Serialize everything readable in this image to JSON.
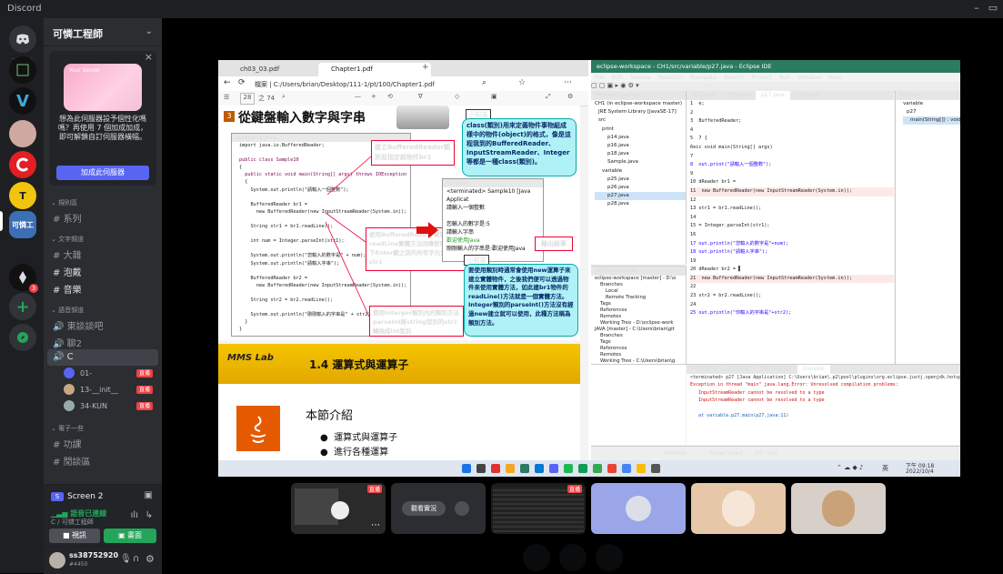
{
  "app": {
    "title": "Discord"
  },
  "server": {
    "name": "可憐工程師"
  },
  "promo": {
    "tag": "Your Server",
    "text": "想為此伺服器設予個性化嗎嗎？再使用 7 個加成加成，即可解鎖自訂伺服器橫幅。",
    "button": "加成此伺服器"
  },
  "categories": {
    "text": "文字頻道",
    "voice": "語音頻道",
    "forum": "電子一些"
  },
  "top_channel": "系列",
  "text_channels": [
    "大雜",
    "泡戴",
    "音樂"
  ],
  "voice_channels": [
    "東談談吧",
    "聊2",
    "C"
  ],
  "voice_users": [
    {
      "name": "01-",
      "status": "直播"
    },
    {
      "name": "13-__init__",
      "status": "直播"
    },
    {
      "name": "34-KUN",
      "status": "直播"
    }
  ],
  "more_channels": [
    "功課",
    "閒談區"
  ],
  "screen_share": {
    "label": "Screen 2"
  },
  "voice_status": {
    "title": "語音已連線",
    "subtitle": "C / 可憐工程師"
  },
  "voice_buttons": {
    "camera": "視訊",
    "screen": "畫面"
  },
  "user": {
    "name": "ss38752920",
    "tag": "#4450"
  },
  "pdf": {
    "tabs": [
      "ch03_03.pdf",
      "Chapter1.pdf"
    ],
    "address": "檔案 | C:/Users/brian/Desktop/111-1/pt/100/Chapter1.pdf",
    "page_num": "28",
    "page_total": "之 74",
    "slide_title": "從鍵盤輸入數字與字串",
    "code_file": "Sample10.java",
    "code_lines": [
      "import java.io.BufferedReader;",
      "",
      "public class Sample10",
      "{",
      "  public static void main(String[] args) throws IOException",
      "  {",
      "    System.out.println(\"請輸入一個整數\");",
      "",
      "    BufferedReader br1 =",
      "      new BufferedReader(new InputStreamReader(System.in));",
      "",
      "    String str1 = br1.readLine();",
      "",
      "    int num = Integer.parseInt(str1);",
      "",
      "    System.out.println(\"您輸入的數字是\" + num);",
      "    System.out.println(\"請輸入字串\");",
      "",
      "    BufferedReader br2 =",
      "      new BufferedReader(new InputStreamReader(System.in));",
      "",
      "    String str2 = br2.readLine();",
      "",
      "    System.out.println(\"剛剛輸入的字串是\" + str2);",
      "  }",
      "}"
    ],
    "note1": "建立BufferedReader類別並指定給物件br1",
    "note2": "使用BufferedReader類別的readLine實體方法回傳使用者在按下Enter鍵之前的所有字元並放到str1",
    "note3": "使用Interger類別內的類別方法parseInt將string型別的str1轉換成int型別",
    "tip_label1": "小知識",
    "tip1": "class(類別)用來定義物件事物組成樣中的物件(object)的格式，像是這程我到的BufferedReader、InputStreamReader、Integer等都是一種class(類別)。",
    "tip_label2": "小知識",
    "tip2": "要使用類別時通常會使用new運算子來建立實體物件，之後我們便可以透過物件來使用實體方法，如此建br1物件的readLine()方法就是一個實體方法。Integer類別的parseInt()方法沒有經過new建立就可以使用，此種方法稱為類別方法。",
    "console_title": "Console",
    "console_lines": [
      "<terminated> Sample10 [Java Applicat",
      "請輸入一個整數",
      "",
      "您輸入的數字是:5",
      "請輸入字串",
      "歡迎使用Java",
      "剛剛輸入的字串是:歡迎使用Java"
    ],
    "output_label": "輸出結果",
    "slide2_brand": "MMS Lab",
    "slide2_title": "1.4 運算式與運算子",
    "slide2_intro": "本節介紹",
    "slide2_bullets": [
      "運算式與運算子",
      "進行各種運算"
    ]
  },
  "eclipse": {
    "title": "eclipse-workspace - CH1/src/variable/p27.java - Eclipse IDE",
    "menu": [
      "File",
      "Edit",
      "Source",
      "Refactor",
      "Navigate",
      "Search",
      "Project",
      "Run",
      "Window",
      "Help"
    ],
    "package_explorer": "Package Explorer",
    "tree": [
      "CH1 (in eclipse-workspace master)",
      "JRE System Library [JavaSE-17]",
      "src",
      "print",
      "p14.java",
      "p16.java",
      "p18.java",
      "Sample.java",
      "variable",
      "p25.java",
      "p26.java",
      "p27.java",
      "p28.java"
    ],
    "editor_tabs": [
      "p25.java",
      "p26.java",
      "p27.java",
      "p28.java"
    ],
    "outline": "Outline",
    "outline_items": [
      "variable",
      "p27",
      "main(String[]) : void"
    ],
    "code_lines": [
      "1  e;",
      "2",
      "3  BufferedReader;",
      "4",
      "5  7 {",
      "6⊖ic void main(String[] args)",
      "7",
      "8  out.print(\"請輸入一個整數\");",
      "9",
      "10 dReader br1 =",
      "11  new BufferedReader(new InputStreamReader(System.in));",
      "12",
      "13 str1 = br1.readLine();",
      "14",
      "15 = Integer.parseInt(str1);",
      "16",
      "17 out.println(\"您輸入的數字是\"+num);",
      "18 out.println(\"請輸入字串\");",
      "19",
      "20 dReader br2 = ▌",
      "21  new BufferedReader(new InputStreamReader(System.in));",
      "22",
      "23 str2 = br2.readLine();",
      "24",
      "25 out.println(\"你輸入的字串是\"+str2);"
    ],
    "git": "Git Repositories",
    "git_items": [
      "eclipse-workspace [master] - D:\\e",
      "Branches",
      "Local",
      "Remote Tracking",
      "Tags",
      "References",
      "Remotes",
      "Working Tree - D:\\eclipse-work",
      "JAVA [master] - C:\\Users\\brian\\git",
      "Branches",
      "Tags",
      "References",
      "Remotes",
      "Working Tree - C:\\Users\\brian\\g"
    ],
    "bottom_tabs": [
      "Problems",
      "Javadoc",
      "Declaration",
      "Console"
    ],
    "console_lines": [
      "<terminated> p27 [Java Application] C:\\Users\\brian\\.p2\\pool\\plugins\\org.eclipse.justj.openjdk.hotspot.jre.full.win32.x86_64_17",
      "Exception in thread \"main\" java.lang.Error: Unresolved compilation problems:",
      "   InputStreamReader cannot be resolved to a type",
      "   InputStreamReader cannot be resolved to a type",
      "",
      "   at variable.p27.main(p27.java:11)"
    ],
    "status": [
      "Writable",
      "Smart Insert",
      "20 : 420"
    ]
  },
  "taskbar": {
    "time": "下午 09:18",
    "date": "2022/10/4",
    "lang": "英"
  },
  "thumbs": [
    {
      "label": "直播"
    },
    {
      "label": "觀看實況"
    },
    {
      "label": "直播"
    }
  ]
}
